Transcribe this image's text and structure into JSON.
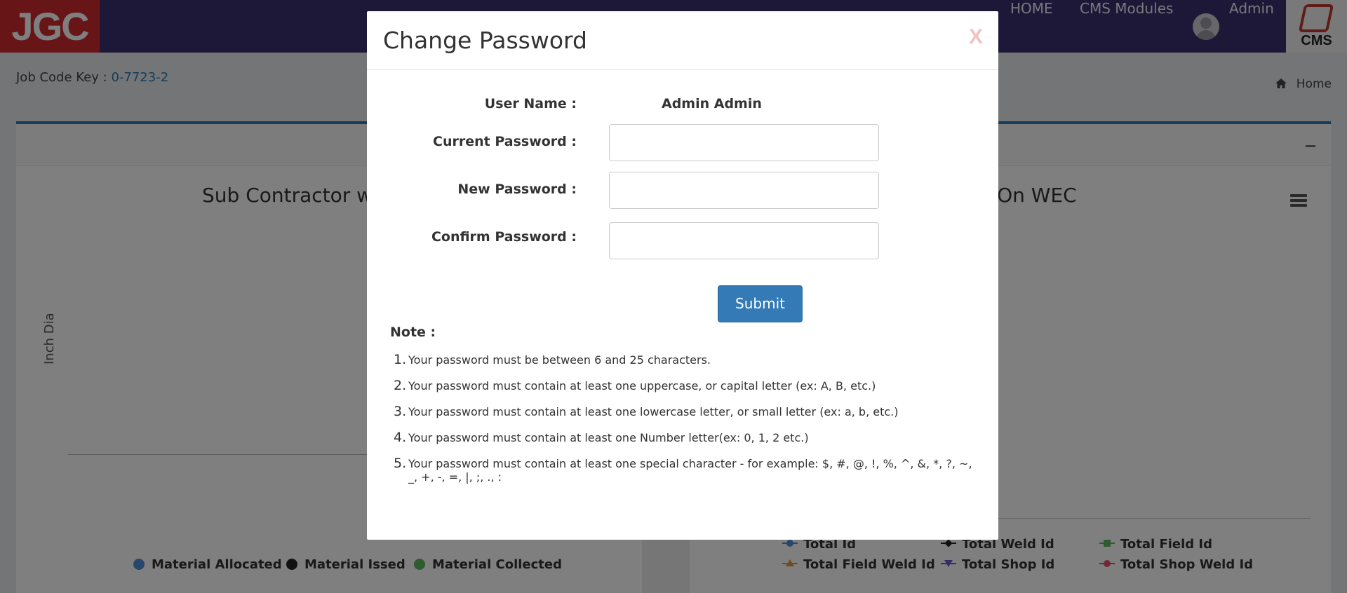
{
  "header": {
    "logo_text": "JGC",
    "nav_home": "HOME",
    "nav_modules": "CMS Modules",
    "user_name": "Admin",
    "cms_logo_text": "CMS"
  },
  "page": {
    "job_code_label": "Job Code Key :",
    "job_code_value": "0-7723-2",
    "breadcrumb_home": "Home",
    "chart_left_title_visible": "Sub Contractor wi",
    "chart_right_title_visible": "ss On WEC",
    "chart_left_ylabel": "Inch Dia",
    "left_legend": [
      "Material Allocated",
      "Material Issed",
      "Material Collected"
    ],
    "right_legend": [
      "Total Id",
      "Total Weld Id",
      "Total Field Id",
      "Total Field Weld Id",
      "Total Shop Id",
      "Total Shop Weld Id"
    ],
    "colors": {
      "left_legend": [
        "#4f8fd6",
        "#222222",
        "#5cb85c"
      ],
      "right_legend": [
        "#4f8fd6",
        "#222222",
        "#5cb85c",
        "#e8953a",
        "#6a5acd",
        "#e0546b"
      ]
    }
  },
  "modal": {
    "title": "Change Password",
    "close_label": "X",
    "user_name_label": "User Name :",
    "user_name_value": "Admin Admin",
    "current_password_label": "Current Password :",
    "new_password_label": "New Password :",
    "confirm_password_label": "Confirm Password :",
    "submit_label": "Submit",
    "note_label": "Note :",
    "rules": [
      "Your password must be between 6 and 25 characters.",
      "Your password must contain at least one uppercase, or capital letter (ex: A, B, etc.)",
      "Your password must contain at least one lowercase letter, or small letter (ex: a, b, etc.)",
      "Your password must contain at least one Number letter(ex: 0, 1, 2 etc.)",
      "Your password must contain at least one special character - for example: $, #, @, !, %, ^, &, *, ?, ~, _, +, -, =, |, ;, ., :"
    ]
  }
}
